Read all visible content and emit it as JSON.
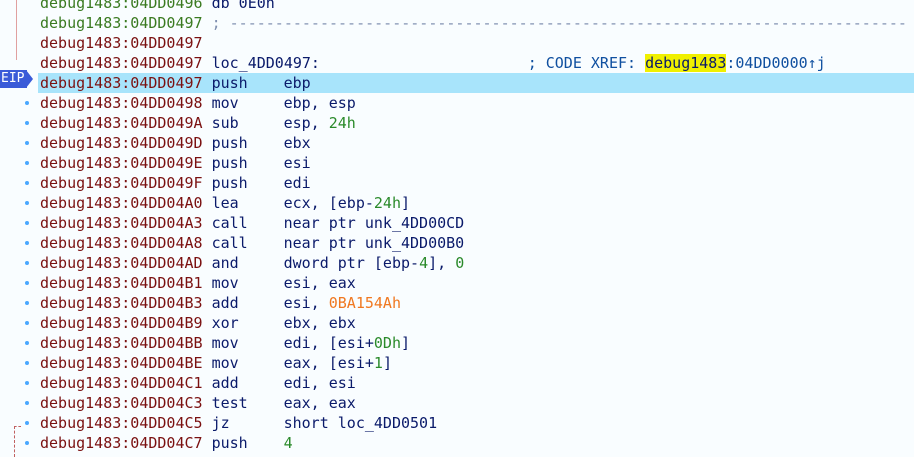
{
  "eip_label": "EIP",
  "top_line": {
    "addr": "debug1483:04DD0496",
    "text": "db 0E0h"
  },
  "separator": "; ---------------------------------------------------------------------------",
  "blank_addr": "debug1483:04DD0497",
  "label_line": {
    "addr": "debug1483:04DD0497",
    "label": "loc_4DD0497:",
    "xref_prefix": "; CODE XREF: ",
    "xref_seg": "debug1483",
    "xref_rest": ":04DD0000↑j"
  },
  "instructions": [
    {
      "addr": "debug1483:04DD0497",
      "mn": "push",
      "ops": [
        {
          "t": "ebp",
          "c": "op"
        }
      ]
    },
    {
      "addr": "debug1483:04DD0498",
      "mn": "mov",
      "ops": [
        {
          "t": "ebp, esp",
          "c": "op"
        }
      ]
    },
    {
      "addr": "debug1483:04DD049A",
      "mn": "sub",
      "ops": [
        {
          "t": "esp, ",
          "c": "op"
        },
        {
          "t": "24h",
          "c": "num"
        }
      ]
    },
    {
      "addr": "debug1483:04DD049D",
      "mn": "push",
      "ops": [
        {
          "t": "ebx",
          "c": "op"
        }
      ]
    },
    {
      "addr": "debug1483:04DD049E",
      "mn": "push",
      "ops": [
        {
          "t": "esi",
          "c": "op"
        }
      ]
    },
    {
      "addr": "debug1483:04DD049F",
      "mn": "push",
      "ops": [
        {
          "t": "edi",
          "c": "op"
        }
      ]
    },
    {
      "addr": "debug1483:04DD04A0",
      "mn": "lea",
      "ops": [
        {
          "t": "ecx, [ebp-",
          "c": "op"
        },
        {
          "t": "24h",
          "c": "num"
        },
        {
          "t": "]",
          "c": "op"
        }
      ]
    },
    {
      "addr": "debug1483:04DD04A3",
      "mn": "call",
      "ops": [
        {
          "t": "near ptr unk_4DD00CD",
          "c": "op"
        }
      ]
    },
    {
      "addr": "debug1483:04DD04A8",
      "mn": "call",
      "ops": [
        {
          "t": "near ptr unk_4DD00B0",
          "c": "op"
        }
      ]
    },
    {
      "addr": "debug1483:04DD04AD",
      "mn": "and",
      "ops": [
        {
          "t": "dword ptr [ebp-",
          "c": "op"
        },
        {
          "t": "4",
          "c": "num"
        },
        {
          "t": "], ",
          "c": "op"
        },
        {
          "t": "0",
          "c": "num"
        }
      ]
    },
    {
      "addr": "debug1483:04DD04B1",
      "mn": "mov",
      "ops": [
        {
          "t": "esi, eax",
          "c": "op"
        }
      ]
    },
    {
      "addr": "debug1483:04DD04B3",
      "mn": "add",
      "ops": [
        {
          "t": "esi, ",
          "c": "op"
        },
        {
          "t": "0BA154Ah",
          "c": "num-o"
        }
      ]
    },
    {
      "addr": "debug1483:04DD04B9",
      "mn": "xor",
      "ops": [
        {
          "t": "ebx, ebx",
          "c": "op"
        }
      ]
    },
    {
      "addr": "debug1483:04DD04BB",
      "mn": "mov",
      "ops": [
        {
          "t": "edi, [esi+",
          "c": "op"
        },
        {
          "t": "0Dh",
          "c": "num"
        },
        {
          "t": "]",
          "c": "op"
        }
      ]
    },
    {
      "addr": "debug1483:04DD04BE",
      "mn": "mov",
      "ops": [
        {
          "t": "eax, [esi+",
          "c": "op"
        },
        {
          "t": "1",
          "c": "num"
        },
        {
          "t": "]",
          "c": "op"
        }
      ]
    },
    {
      "addr": "debug1483:04DD04C1",
      "mn": "add",
      "ops": [
        {
          "t": "edi, esi",
          "c": "op"
        }
      ]
    },
    {
      "addr": "debug1483:04DD04C3",
      "mn": "test",
      "ops": [
        {
          "t": "eax, eax",
          "c": "op"
        }
      ]
    },
    {
      "addr": "debug1483:04DD04C5",
      "mn": "jz",
      "ops": [
        {
          "t": "short loc_4DD0501",
          "c": "op"
        }
      ]
    },
    {
      "addr": "debug1483:04DD04C7",
      "mn": "push",
      "ops": [
        {
          "t": "4",
          "c": "num"
        }
      ]
    }
  ],
  "colors": {
    "current_line": "#a8e4fb",
    "eip_badge": "#3a5bd8",
    "xref_highlight": "#f0f000"
  }
}
